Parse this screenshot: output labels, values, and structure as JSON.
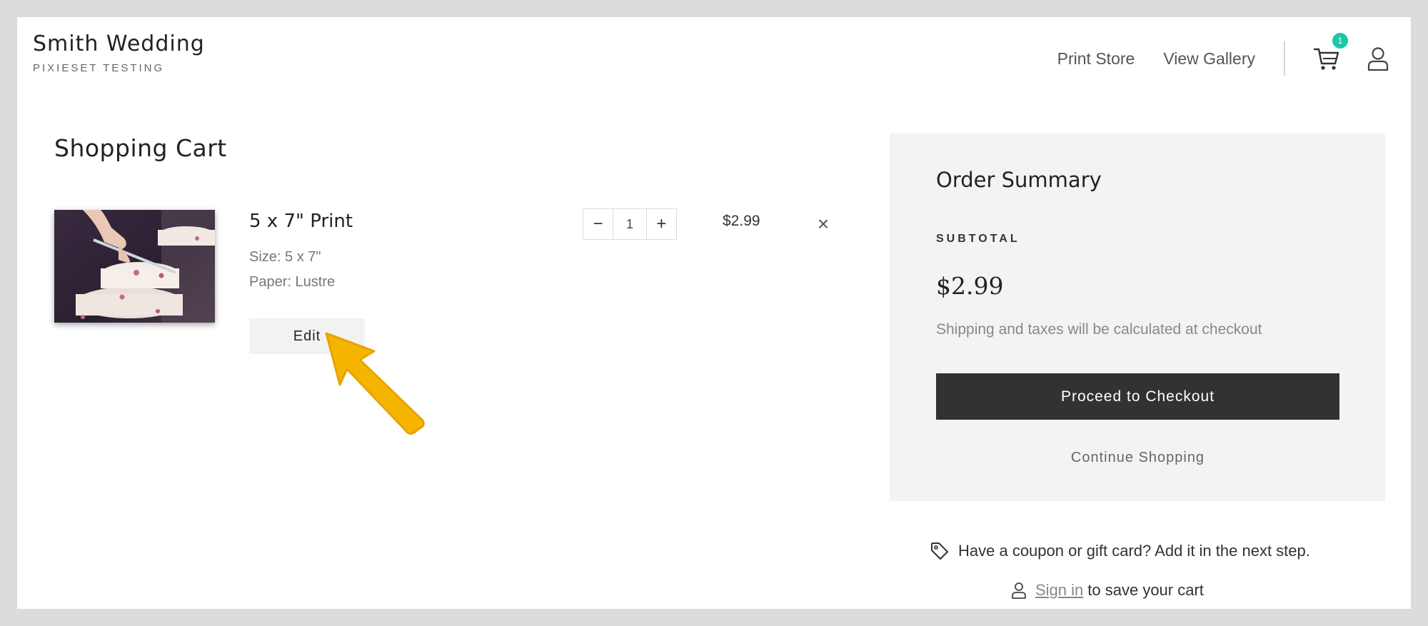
{
  "header": {
    "title": "Smith Wedding",
    "subtitle": "PIXIESET TESTING",
    "nav": [
      "Print Store",
      "View Gallery"
    ],
    "cart_count": "1",
    "icons": [
      "cart-icon",
      "user-icon"
    ]
  },
  "cart": {
    "title": "Shopping Cart",
    "items": [
      {
        "name": "5 x 7\" Print",
        "size": "Size: 5 x 7\"",
        "paper": "Paper: Lustre",
        "edit_label": "Edit",
        "quantity": "1",
        "minus": "−",
        "plus": "+",
        "price": "$2.99",
        "remove": "×"
      }
    ]
  },
  "summary": {
    "title": "Order Summary",
    "subtotal_label": "SUBTOTAL",
    "subtotal": "$2.99",
    "note": "Shipping and taxes will be calculated at checkout",
    "checkout_label": "Proceed to Checkout",
    "continue_label": "Continue Shopping"
  },
  "footer": {
    "coupon_text": "Have a coupon or gift card? Add it in the next step.",
    "signin_link": "Sign in",
    "signin_text": "to save your cart"
  },
  "colors": {
    "badge": "#1ec7a6",
    "checkout_button": "#323232",
    "annotation_arrow": "#f5b400"
  }
}
